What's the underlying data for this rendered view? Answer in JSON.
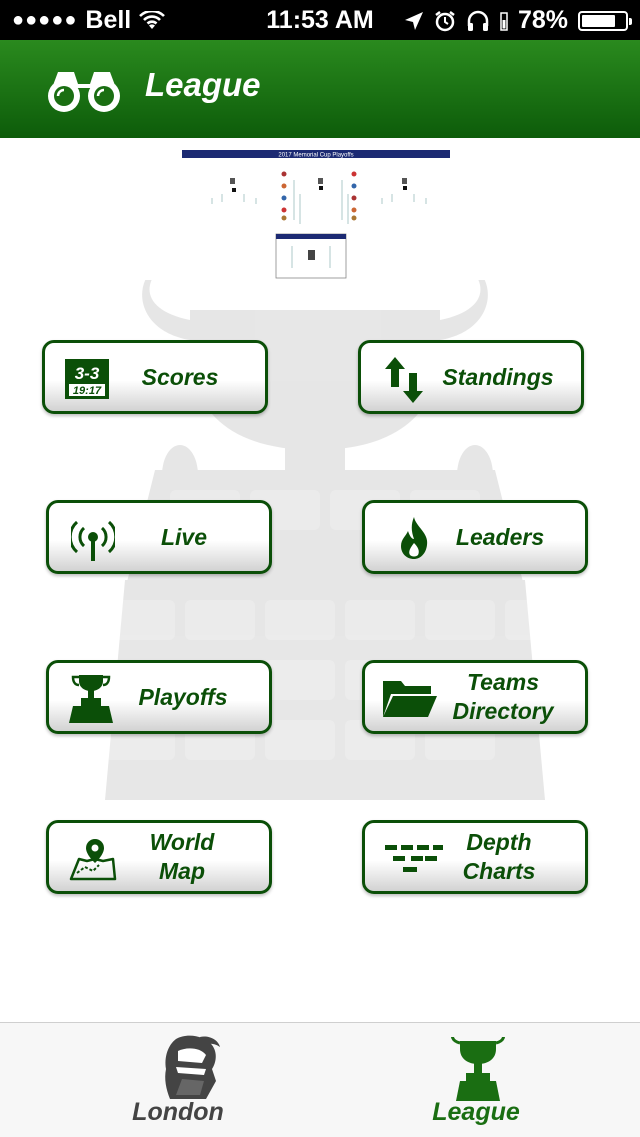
{
  "status_bar": {
    "carrier": "Bell",
    "time": "11:53 AM",
    "battery": "78%",
    "battery_level": 0.78
  },
  "header": {
    "title": "League"
  },
  "bracket_image": {
    "caption": "2017 Memorial Cup Playoffs"
  },
  "menu": {
    "scores": {
      "label": "Scores",
      "icon": "scoreboard-icon",
      "score": "3-3",
      "clock": "19:17"
    },
    "standings": {
      "label": "Standings",
      "icon": "up-down-arrows-icon"
    },
    "live": {
      "label": "Live",
      "icon": "broadcast-icon"
    },
    "leaders": {
      "label": "Leaders",
      "icon": "flame-icon"
    },
    "playoffs": {
      "label": "Playoffs",
      "icon": "trophy-icon"
    },
    "teams_directory": {
      "label_line1": "Teams",
      "label_line2": "Directory",
      "icon": "folder-icon"
    },
    "world_map": {
      "label_line1": "World",
      "label_line2": "Map",
      "icon": "map-pin-icon"
    },
    "depth_charts": {
      "label_line1": "Depth",
      "label_line2": "Charts",
      "icon": "depth-chart-icon"
    }
  },
  "tabbar": {
    "tabs": [
      {
        "label": "London",
        "icon": "knight-helmet-icon",
        "active": false
      },
      {
        "label": "League",
        "icon": "trophy-icon",
        "active": true
      }
    ]
  },
  "colors": {
    "brand_green": "#0b4f08",
    "header_green": "#1e7a14",
    "inactive_tab": "#444444"
  }
}
